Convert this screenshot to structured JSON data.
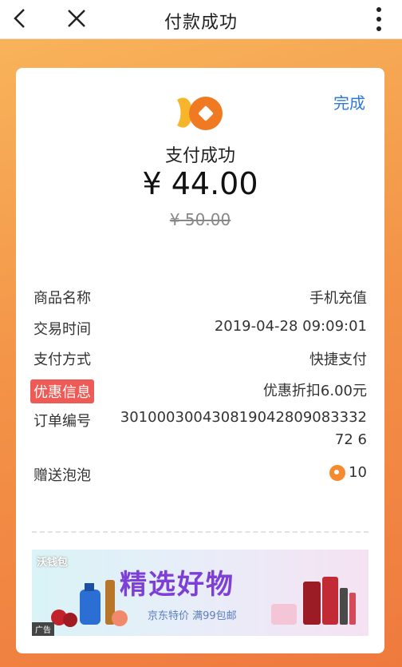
{
  "header": {
    "title": "付款成功"
  },
  "actions": {
    "done": "完成"
  },
  "payment": {
    "status": "支付成功",
    "amount": "¥ 44.00",
    "original_amount": "¥ 50.00"
  },
  "details": {
    "product_label": "商品名称",
    "product_value": "手机充值",
    "time_label": "交易时间",
    "time_value": "2019-04-28 09:09:01",
    "method_label": "支付方式",
    "method_value": "快捷支付",
    "discount_label": "优惠信息",
    "discount_value": "优惠折扣6.00元",
    "order_label": "订单编号",
    "order_value": "30100030043081904280908333272 6",
    "bubble_label": "赠送泡泡",
    "bubble_value": "10"
  },
  "ad": {
    "brand": "沃钱包",
    "slogan": "精选好物",
    "promo": "京东特价  满99包邮",
    "tag": "广告"
  },
  "colors": {
    "accent_orange": "#f39448",
    "link_blue": "#2f79d8",
    "badge_red": "#ee5a55"
  }
}
